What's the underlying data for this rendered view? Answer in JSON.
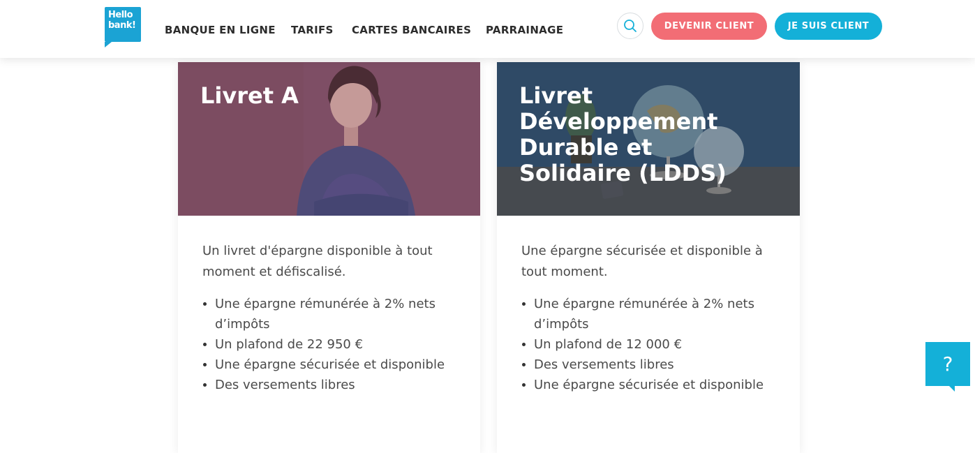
{
  "header": {
    "logo": {
      "line1": "Hello",
      "line2": "bank!"
    },
    "nav": [
      {
        "label": "BANQUE EN LIGNE"
      },
      {
        "label": "TARIFS"
      },
      {
        "label": "CARTES BANCAIRES"
      },
      {
        "label": "PARRAINAGE"
      }
    ],
    "search_icon": "search-icon",
    "devenir_client_label": "DEVENIR CLIENT",
    "je_suis_client_label": "JE SUIS CLIENT"
  },
  "colors": {
    "brand_blue": "#14b0d8",
    "coral": "#f26d75",
    "card_a_overlay": "#7e4d63",
    "card_l_overlay": "#2d4866"
  },
  "cards": [
    {
      "title": "Livret A",
      "description": "Un livret d'épargne disponible à tout moment et défiscalisé.",
      "features": [
        "Une épargne rémunérée à 2% nets d’impôts",
        "Un plafond de 22 950 €",
        "Une épargne sécurisée et disponible",
        "Des versements libres"
      ]
    },
    {
      "title": "Livret Développement Durable et Solidaire (LDDS)",
      "description": "Une épargne sécurisée et disponible à tout moment.",
      "features": [
        "Une épargne rémunérée à 2% nets d’impôts",
        "Un plafond de 12 000 €",
        "Des versements libres",
        "Une épargne sécurisée et disponible"
      ]
    }
  ],
  "help": {
    "label": "?"
  }
}
